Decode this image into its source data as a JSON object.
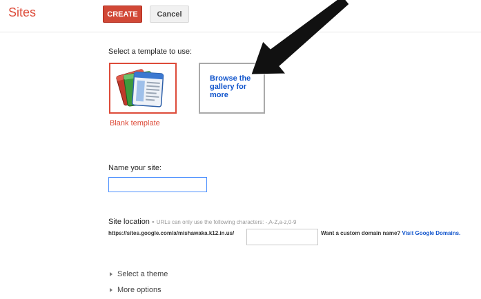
{
  "header": {
    "app_title": "Sites",
    "create_label": "CREATE",
    "cancel_label": "Cancel"
  },
  "template": {
    "prompt": "Select a template to use:",
    "blank_caption": "Blank template",
    "browse_text": "Browse the gallery for more"
  },
  "name": {
    "label": "Name your site:",
    "value": ""
  },
  "location": {
    "label": "Site location",
    "separator": " - ",
    "hint": "URLs can only use the following characters: -,A-Z,a-z,0-9",
    "url_prefix": "https://sites.google.com/a/mishawaka.k12.in.us/",
    "value": "",
    "domain_question": "Want a custom domain name?",
    "domain_link": "Visit Google Domains."
  },
  "options": {
    "theme_label": "Select a theme",
    "more_label": "More options"
  },
  "colors": {
    "accent_red": "#dd4b39",
    "link_blue": "#1155cc",
    "arrow": "#111111"
  },
  "icons": [
    "sites-template-icon",
    "expand-triangle-icon",
    "annotation-arrow"
  ]
}
